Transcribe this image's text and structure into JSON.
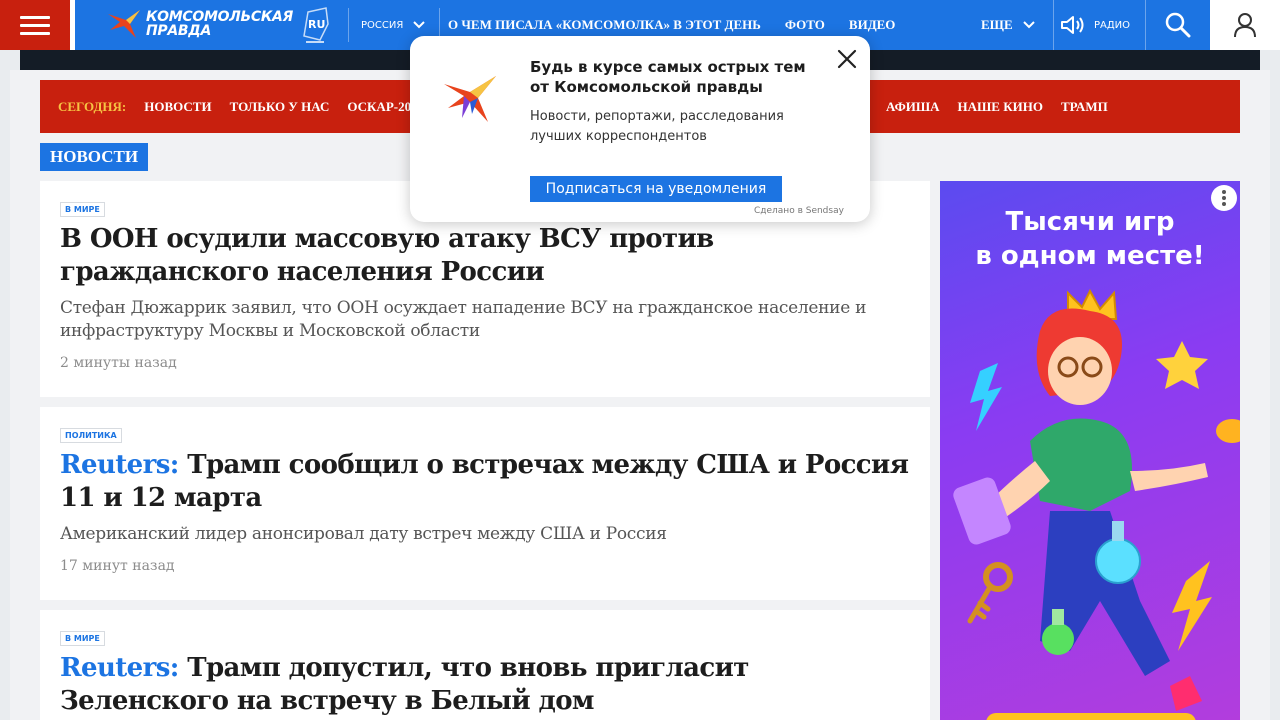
{
  "header": {
    "logo_line1": "КОМСОМОЛЬСКАЯ",
    "logo_line2": "ПРАВДА",
    "logo_badge": "RU",
    "region": "РОССИЯ",
    "nav": [
      "О ЧЕМ ПИСАЛА «КОМСОМОЛКА» В ЭТОТ ДЕНЬ",
      "ФОТО",
      "ВИДЕО"
    ],
    "more_label": "ЕЩЕ",
    "radio_label": "РАДИО"
  },
  "red_nav": {
    "today_label": "СЕГОДНЯ:",
    "items_left": [
      "НОВОСТИ",
      "ТОЛЬКО У НАС",
      "ОСКАР-2025"
    ],
    "items_right": [
      "АФИША",
      "НАШЕ КИНО",
      "ТРАМП"
    ]
  },
  "section_title": "НОВОСТИ",
  "articles": [
    {
      "rubric": "В МИРЕ",
      "source": "",
      "title": "В ООН осудили массовую атаку ВСУ против гражданского населения России",
      "lead": "Стефан Дюжаррик заявил, что ООН осуждает нападение ВСУ на гражданское население и инфраструктуру Москвы и Московской области",
      "time": "2 минуты назад"
    },
    {
      "rubric": "ПОЛИТИКА",
      "source": "Reuters:",
      "title": "Трамп сообщил о встречах между США и Россия 11 и 12 марта",
      "lead": "Американский лидер анонсировал дату встреч между США и Россия",
      "time": "17 минут назад"
    },
    {
      "rubric": "В МИРЕ",
      "source": "Reuters:",
      "title": "Трамп допустил, что вновь пригласит Зеленского на встречу в Белый дом",
      "lead": "",
      "time": ""
    }
  ],
  "ad": {
    "title_line1": "Тысячи игр",
    "title_line2": "в одном месте!"
  },
  "popup": {
    "title": "Будь в курсе самых острых тем от Комсомольской правды",
    "description": "Новости, репортажи, расследования лучших корреспондентов",
    "button_label": "Подписаться на уведомления",
    "footer": "Сделано в Sendsay"
  },
  "colors": {
    "brand_blue": "#1c74e2",
    "brand_red": "#c8200e",
    "today_yellow": "#f6c343"
  }
}
